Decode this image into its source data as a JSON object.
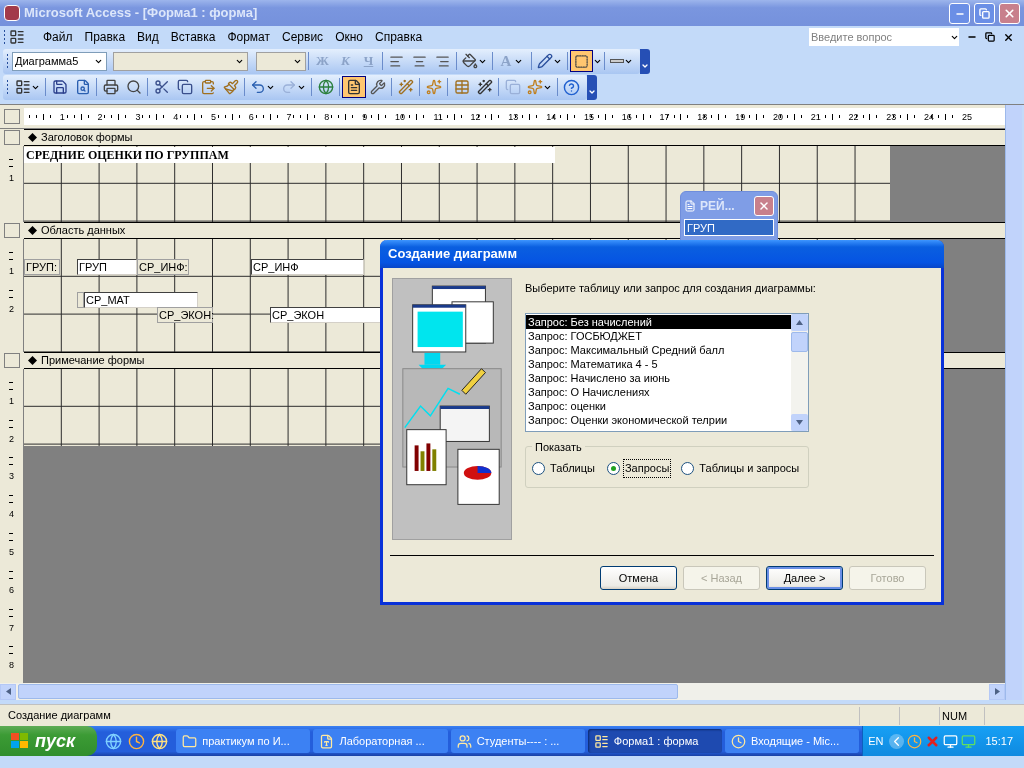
{
  "window": {
    "title": "Microsoft Access - [Форма1 : форма]"
  },
  "menu": [
    "Файл",
    "Правка",
    "Вид",
    "Вставка",
    "Формат",
    "Сервис",
    "Окно",
    "Справка"
  ],
  "help_box": {
    "placeholder": "Введите вопрос"
  },
  "format_toolbar": {
    "object_box": "Диаграмма5",
    "text_buttons": [
      {
        "text": "Ж",
        "disabled": true
      },
      {
        "text": "К",
        "disabled": true
      },
      {
        "text": "Ч",
        "disabled": true
      }
    ],
    "font_color": {
      "text": "A",
      "disabled": true
    },
    "border_pressed": true
  },
  "design_toolbar": {
    "properties_pressed": true
  },
  "ruler": [
    "1",
    "2",
    "3",
    "4",
    "5",
    "6",
    "7",
    "8",
    "9",
    "10",
    "11",
    "12",
    "13",
    "14",
    "15",
    "16",
    "17",
    "18",
    "19",
    "20",
    "21",
    "22",
    "23",
    "24",
    "25"
  ],
  "form": {
    "sections": [
      {
        "title": "Заголовок формы",
        "ruler": [
          "1"
        ],
        "controls": [
          {
            "kind": "title",
            "text": "СРЕДНИЕ ОЦЕНКИ ПО ГРУППАМ"
          }
        ]
      },
      {
        "title": "Область данных",
        "ruler": [
          "1",
          "2"
        ],
        "controls": [
          {
            "kind": "label",
            "text": "ГРУП:"
          },
          {
            "kind": "textbox",
            "text": "ГРУП"
          },
          {
            "kind": "label",
            "text": "СР_ИНФ:"
          },
          {
            "kind": "textbox",
            "text": "СР_ИНФ"
          },
          {
            "kind": "edge"
          },
          {
            "kind": "textbox",
            "text": "СР_МАТ"
          },
          {
            "kind": "label",
            "text": "СР_ЭКОН:"
          },
          {
            "kind": "textbox",
            "text": "СР_ЭКОН"
          }
        ]
      },
      {
        "title": "Примечание формы",
        "ruler": [
          "1",
          "2",
          "3",
          "4",
          "5",
          "6",
          "7",
          "8"
        ]
      }
    ]
  },
  "field_list": {
    "title": "РЕЙ...",
    "fields": [
      {
        "text": "ГРУП",
        "selected": true
      }
    ]
  },
  "dialog": {
    "title": "Создание диаграмм",
    "prompt": "Выберите таблицу или запрос для создания диаграммы:",
    "list": [
      {
        "text": "Запрос: Без начислений",
        "selected": true
      },
      {
        "text": "Запрос: ГОСБЮДЖЕТ",
        "selected": false
      },
      {
        "text": "Запрос: Максимальный Средний балл",
        "selected": false
      },
      {
        "text": "Запрос: Математика 4 - 5",
        "selected": false
      },
      {
        "text": "Запрос: Начислено за июнь",
        "selected": false
      },
      {
        "text": "Запрос: О Начислениях",
        "selected": false
      },
      {
        "text": "Запрос: оценки",
        "selected": false
      },
      {
        "text": "Запрос: Оценки экономической телрии",
        "selected": false
      }
    ],
    "group": {
      "title": "Показать",
      "options": [
        {
          "label": "Таблицы",
          "selected": false
        },
        {
          "label": "Запросы",
          "selected": true
        },
        {
          "label": "Таблицы и запросы",
          "selected": false
        }
      ]
    },
    "buttons": [
      {
        "label": "Отмена",
        "disabled": false,
        "default": false
      },
      {
        "label": "< Назад",
        "disabled": true,
        "default": false
      },
      {
        "label": "Далее >",
        "disabled": false,
        "default": true
      },
      {
        "label": "Готово",
        "disabled": true,
        "default": false
      }
    ]
  },
  "status_bar": {
    "text": "Создание диаграмм",
    "indicator": "NUM"
  },
  "taskbar": {
    "start": "пуск",
    "tasks": [
      {
        "label": "практикум по И...",
        "selected": false
      },
      {
        "label": "Лабораторная ...",
        "selected": false
      },
      {
        "label": "Студенты---- : ...",
        "selected": false
      },
      {
        "label": "Форма1 : форма",
        "selected": true
      },
      {
        "label": "Входящие - Mic...",
        "selected": false
      }
    ],
    "language": "EN",
    "clock": "15:17"
  }
}
